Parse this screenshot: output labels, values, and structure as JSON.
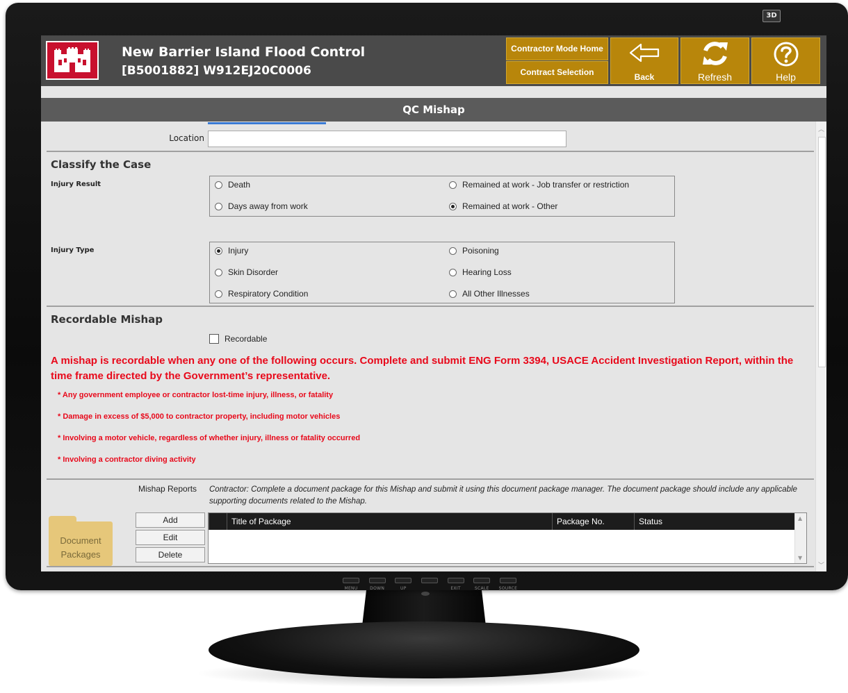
{
  "monitor": {
    "badge": "3D",
    "buttons": [
      "MENU",
      "DOWN",
      "UP",
      "EXIT",
      "SCALE",
      "SOURCE"
    ]
  },
  "header": {
    "title": "New Barrier Island Flood Control",
    "subtitle": "[B5001882] W912EJ20C0006",
    "contractor_home": "Contractor Mode Home",
    "contract_selection": "Contract Selection",
    "back": "Back",
    "refresh": "Refresh",
    "help": "Help",
    "accent": "#b8860b"
  },
  "page": {
    "title": "QC Mishap"
  },
  "location": {
    "label": "Location",
    "value": ""
  },
  "classify": {
    "heading": "Classify the Case",
    "injury_result": {
      "label": "Injury Result",
      "options": [
        {
          "label": "Death",
          "selected": false
        },
        {
          "label": "Remained at work - Job transfer or restriction",
          "selected": false
        },
        {
          "label": "Days away from work",
          "selected": false
        },
        {
          "label": "Remained at work - Other",
          "selected": true
        }
      ]
    },
    "injury_type": {
      "label": "Injury Type",
      "options": [
        {
          "label": "Injury",
          "selected": true
        },
        {
          "label": "Poisoning",
          "selected": false
        },
        {
          "label": "Skin Disorder",
          "selected": false
        },
        {
          "label": "Hearing Loss",
          "selected": false
        },
        {
          "label": "Respiratory Condition",
          "selected": false
        },
        {
          "label": "All Other Illnesses",
          "selected": false
        }
      ]
    }
  },
  "recordable": {
    "heading": "Recordable Mishap",
    "checkbox_label": "Recordable",
    "checked": false,
    "notice": "A mishap is recordable when any one of the following occurs. Complete and submit ENG Form 3394, USACE Accident Investigation Report, within the time frame directed by the Government’s representative.",
    "bullets": [
      "* Any government employee or contractor lost-time injury, illness, or fatality",
      "* Damage in excess of $5,000 to contractor property, including motor vehicles",
      "* Involving a motor vehicle, regardless of whether injury, illness or fatality occurred",
      "* Involving a contractor diving activity"
    ],
    "notice_color": "#e8091b"
  },
  "reports": {
    "label": "Mishap Reports",
    "description": "Contractor: Complete a document package for this Mishap and submit it using this document package manager. The document package should include any applicable supporting documents related to the Mishap.",
    "folder_label_1": "Document",
    "folder_label_2": "Packages",
    "add": "Add",
    "edit": "Edit",
    "delete": "Delete",
    "columns": [
      "Title of Package",
      "Package No.",
      "Status"
    ]
  }
}
